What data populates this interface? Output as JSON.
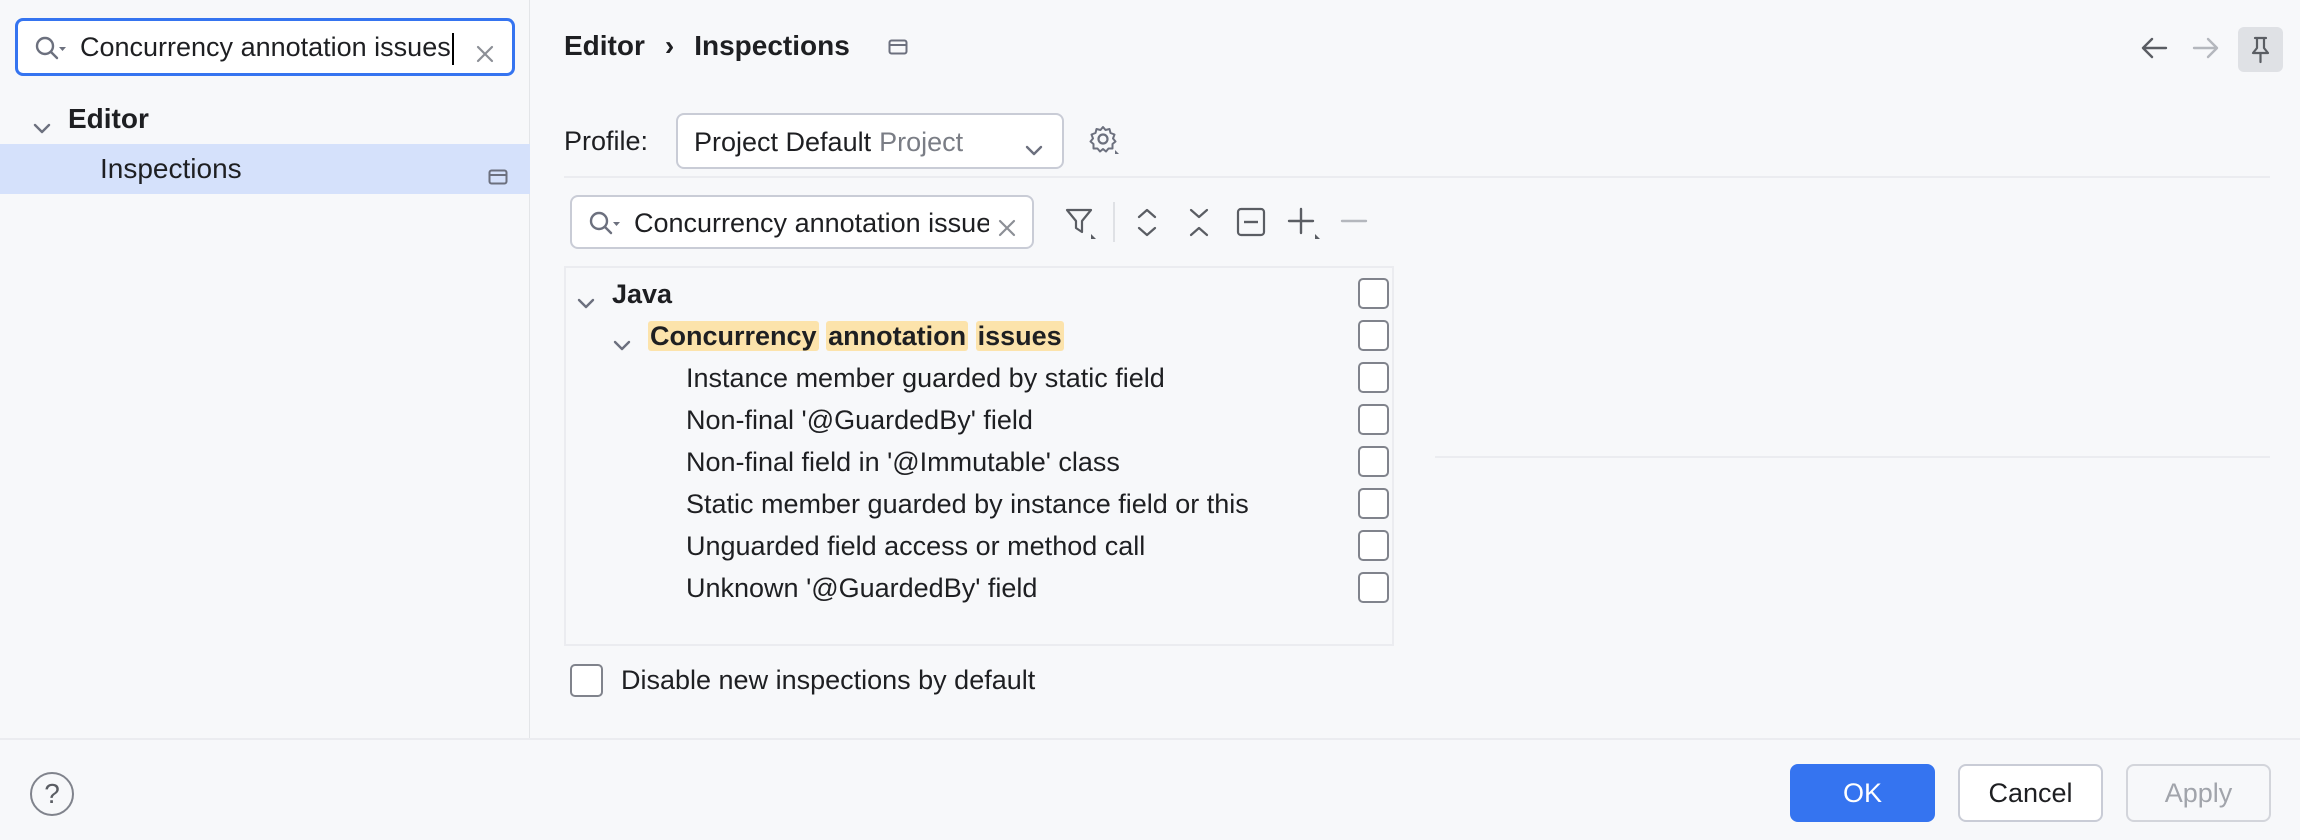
{
  "sidebar": {
    "search_value": "Concurrency annotation issues",
    "tree": [
      {
        "label": "Editor"
      },
      {
        "label": "Inspections"
      }
    ]
  },
  "header": {
    "breadcrumb": [
      "Editor",
      "Inspections"
    ],
    "breadcrumb_sep": "›"
  },
  "profile": {
    "label": "Profile:",
    "value": "Project Default",
    "scope": "Project"
  },
  "filter": {
    "search_value": "Concurrency annotation issues"
  },
  "inspections": {
    "root": "Java",
    "group_words": [
      "Concurrency",
      "annotation",
      "issues"
    ],
    "items": [
      "Instance member guarded by static field",
      "Non-final '@GuardedBy' field",
      "Non-final field in '@Immutable' class",
      "Static member guarded by instance field or this",
      "Unguarded field access or method call",
      "Unknown '@GuardedBy' field"
    ]
  },
  "options": {
    "disable_new_label": "Disable new inspections by default"
  },
  "footer": {
    "help": "?",
    "ok": "OK",
    "cancel": "Cancel",
    "apply": "Apply"
  },
  "colors": {
    "accent": "#3574f0",
    "selection": "#d5e1fb",
    "highlight": "#fce3ab"
  }
}
